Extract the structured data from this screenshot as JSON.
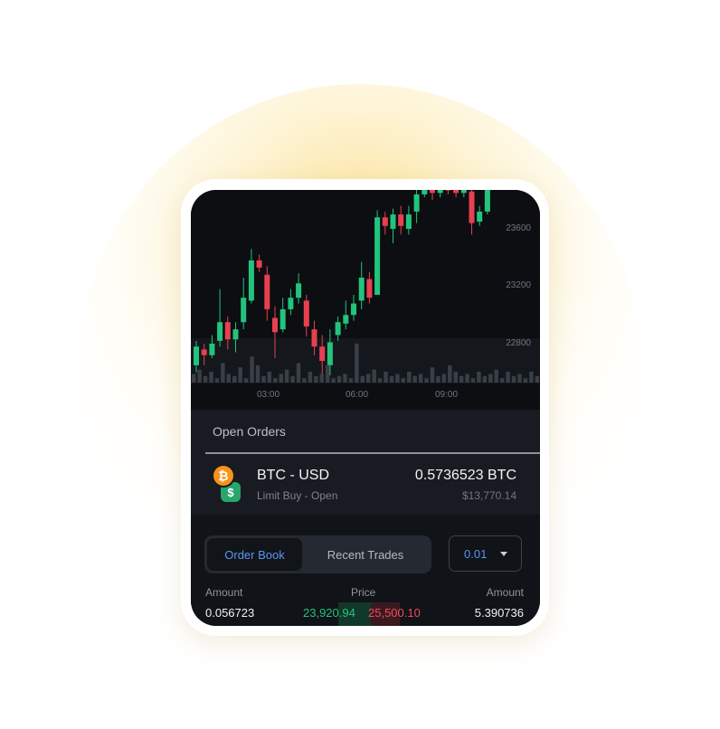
{
  "colors": {
    "bull": "#22c47c",
    "bear": "#e8404f",
    "volume": "#3a3f47",
    "accent": "#5b95f4",
    "bitcoin": "#f7931a",
    "usd": "#26a66b"
  },
  "chart_data": {
    "type": "candlestick",
    "y_ticks": [
      "23600",
      "23200",
      "22800"
    ],
    "x_ticks": [
      "03:00",
      "06:00",
      "09:00"
    ],
    "candles": [
      {
        "o": 22650,
        "c": 22780,
        "h": 22820,
        "l": 22600
      },
      {
        "o": 22760,
        "c": 22720,
        "h": 22800,
        "l": 22650
      },
      {
        "o": 22720,
        "c": 22800,
        "h": 22860,
        "l": 22700
      },
      {
        "o": 22820,
        "c": 22950,
        "h": 23180,
        "l": 22780
      },
      {
        "o": 22950,
        "c": 22830,
        "h": 22990,
        "l": 22760
      },
      {
        "o": 22830,
        "c": 22900,
        "h": 22950,
        "l": 22740
      },
      {
        "o": 22950,
        "c": 23120,
        "h": 23260,
        "l": 22900
      },
      {
        "o": 23100,
        "c": 23380,
        "h": 23460,
        "l": 23080
      },
      {
        "o": 23380,
        "c": 23330,
        "h": 23420,
        "l": 23300
      },
      {
        "o": 23280,
        "c": 23040,
        "h": 23340,
        "l": 22960
      },
      {
        "o": 22980,
        "c": 22880,
        "h": 23060,
        "l": 22700
      },
      {
        "o": 22900,
        "c": 23040,
        "h": 23120,
        "l": 22880
      },
      {
        "o": 23040,
        "c": 23120,
        "h": 23180,
        "l": 23000
      },
      {
        "o": 23120,
        "c": 23220,
        "h": 23290,
        "l": 23080
      },
      {
        "o": 23100,
        "c": 22920,
        "h": 23140,
        "l": 22850
      },
      {
        "o": 22900,
        "c": 22780,
        "h": 22960,
        "l": 22720
      },
      {
        "o": 22780,
        "c": 22680,
        "h": 22860,
        "l": 22550
      },
      {
        "o": 22650,
        "c": 22810,
        "h": 22900,
        "l": 22580
      },
      {
        "o": 22860,
        "c": 22950,
        "h": 22990,
        "l": 22820
      },
      {
        "o": 22940,
        "c": 23000,
        "h": 23100,
        "l": 22900
      },
      {
        "o": 23000,
        "c": 23080,
        "h": 23140,
        "l": 22960
      },
      {
        "o": 23100,
        "c": 23260,
        "h": 23370,
        "l": 23040
      },
      {
        "o": 23250,
        "c": 23120,
        "h": 23300,
        "l": 23080
      },
      {
        "o": 23140,
        "c": 23680,
        "h": 23730,
        "l": 23140
      },
      {
        "o": 23680,
        "c": 23620,
        "h": 23720,
        "l": 23560
      },
      {
        "o": 23600,
        "c": 23700,
        "h": 23740,
        "l": 23500
      },
      {
        "o": 23700,
        "c": 23620,
        "h": 23760,
        "l": 23560
      },
      {
        "o": 23600,
        "c": 23700,
        "h": 23760,
        "l": 23560
      },
      {
        "o": 23720,
        "c": 23840,
        "h": 23880,
        "l": 23640
      },
      {
        "o": 23840,
        "c": 23880,
        "h": 23900,
        "l": 23820
      },
      {
        "o": 23880,
        "c": 23850,
        "h": 23900,
        "l": 23800
      },
      {
        "o": 23850,
        "c": 23880,
        "h": 23900,
        "l": 23820
      },
      {
        "o": 23880,
        "c": 23870,
        "h": 23900,
        "l": 23840
      },
      {
        "o": 23880,
        "c": 23850,
        "h": 23900,
        "l": 23820
      },
      {
        "o": 23850,
        "c": 23880,
        "h": 23900,
        "l": 23820
      },
      {
        "o": 23860,
        "c": 23640,
        "h": 23900,
        "l": 23560
      },
      {
        "o": 23650,
        "c": 23720,
        "h": 23760,
        "l": 23620
      },
      {
        "o": 23720,
        "c": 23900,
        "h": 23920,
        "l": 23700
      }
    ],
    "volumes": [
      4,
      6,
      3,
      5,
      2,
      9,
      4,
      3,
      7,
      2,
      12,
      8,
      3,
      5,
      2,
      4,
      6,
      3,
      9,
      2,
      5,
      3,
      4,
      8,
      2,
      3,
      4,
      2,
      18,
      3,
      4,
      6,
      2,
      5,
      3,
      4,
      2,
      5,
      3,
      4,
      2,
      7,
      3,
      4,
      8,
      5,
      3,
      4,
      2,
      5,
      3,
      4,
      6,
      2,
      5,
      3,
      4,
      2,
      5,
      3
    ]
  },
  "open_orders": {
    "title": "Open Orders",
    "pair": "BTC - USD",
    "order_type": "Limit Buy - Open",
    "amount": "0.5736523 BTC",
    "usd_value": "$13,770.14",
    "btc_symbol": "₿",
    "usd_symbol": "$"
  },
  "tabs": {
    "order_book": "Order Book",
    "recent_trades": "Recent Trades"
  },
  "precision": {
    "selected": "0.01"
  },
  "order_book": {
    "headers": {
      "amount_left": "Amount",
      "price": "Price",
      "amount_right": "Amount"
    },
    "rows": [
      {
        "bid_amount": "0.056723",
        "bid_price": "23,920.94",
        "ask_price": "25,500.10",
        "ask_amount": "5.390736"
      }
    ]
  }
}
